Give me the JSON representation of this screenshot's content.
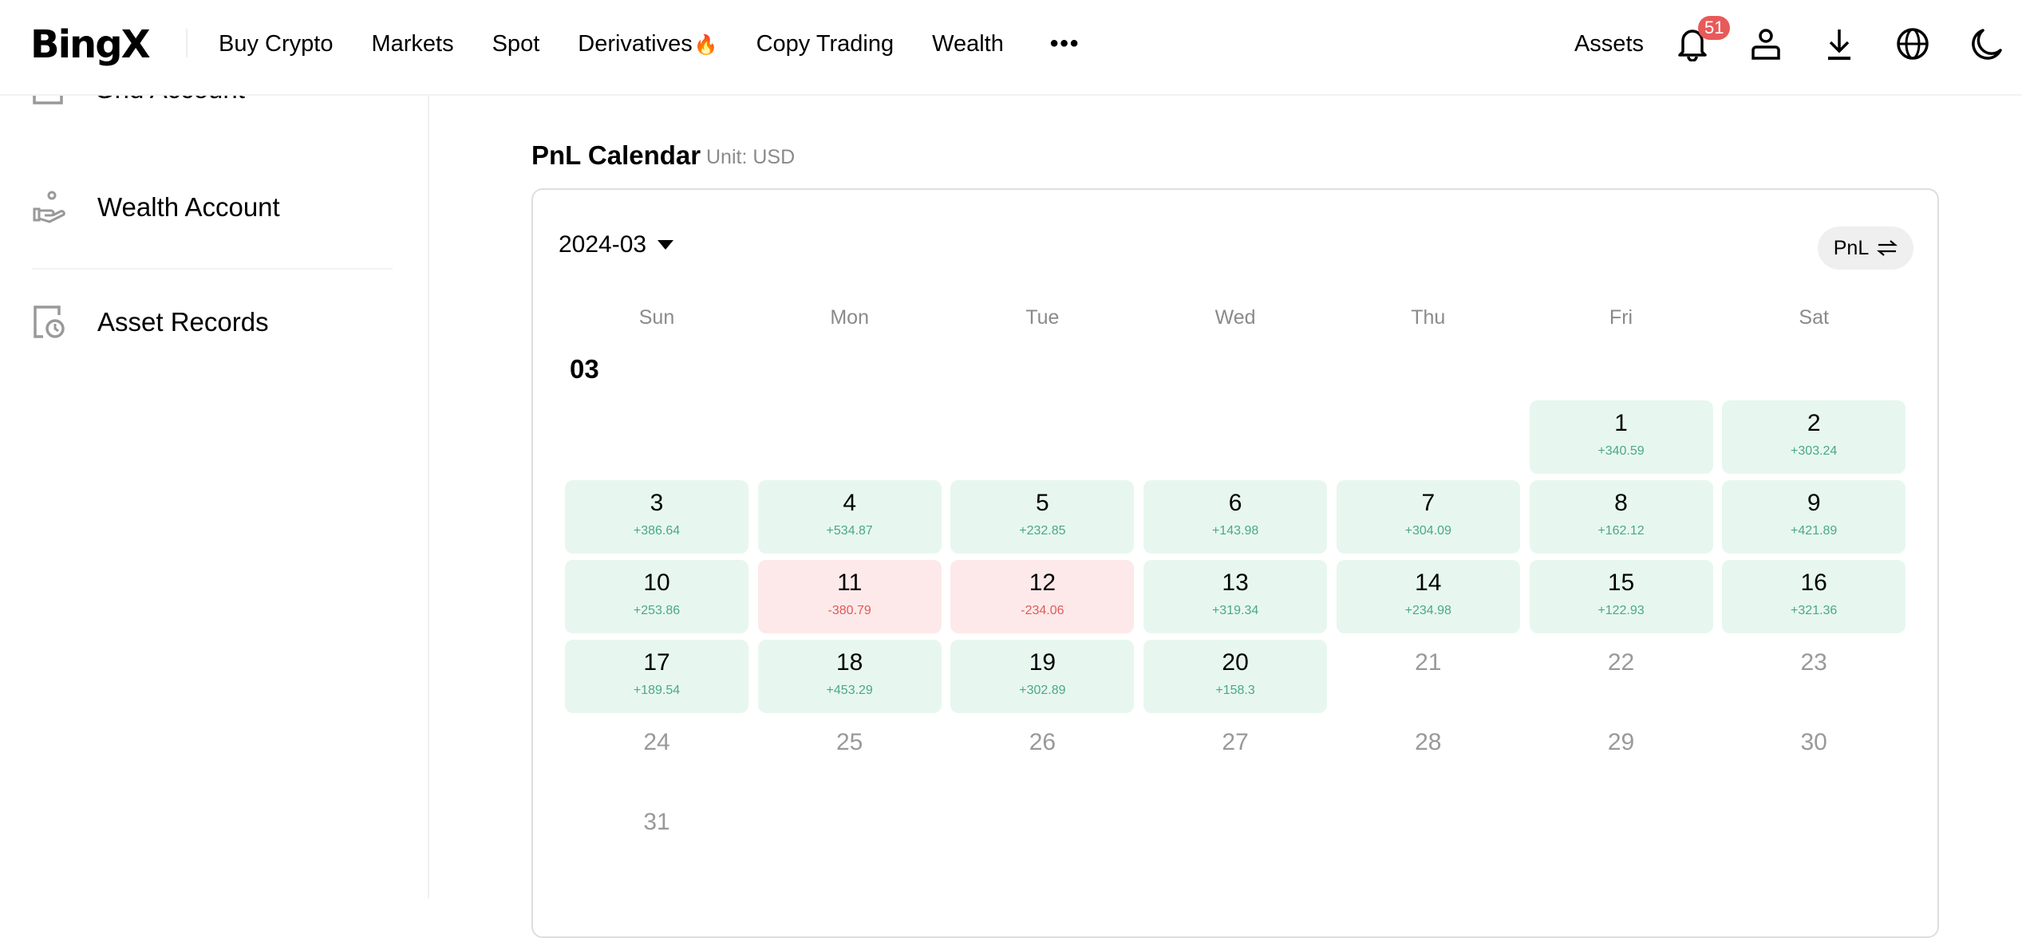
{
  "header": {
    "logo": "BingX",
    "nav": [
      {
        "label": "Buy Crypto"
      },
      {
        "label": "Markets"
      },
      {
        "label": "Spot"
      },
      {
        "label": "Derivatives",
        "badge_icon": "fire-icon"
      },
      {
        "label": "Copy Trading"
      },
      {
        "label": "Wealth"
      }
    ],
    "more_label": "•••",
    "assets_label": "Assets",
    "notification_count": "51"
  },
  "sidebar": {
    "items": [
      {
        "label": "Grid Account",
        "icon": "grid-account-icon"
      },
      {
        "label": "Wealth Account",
        "icon": "hand-coin-icon"
      },
      {
        "label": "Asset Records",
        "icon": "records-clock-icon"
      }
    ]
  },
  "calendar": {
    "title": "PnL Calendar",
    "unit": "Unit: USD",
    "selected_month": "2024-03",
    "toggle_label": "PnL",
    "month_label": "03",
    "weekdays": [
      "Sun",
      "Mon",
      "Tue",
      "Wed",
      "Thu",
      "Fri",
      "Sat"
    ],
    "first_weekday_index": 5,
    "days": [
      {
        "day": "1",
        "pnl": "+340.59"
      },
      {
        "day": "2",
        "pnl": "+303.24"
      },
      {
        "day": "3",
        "pnl": "+386.64"
      },
      {
        "day": "4",
        "pnl": "+534.87"
      },
      {
        "day": "5",
        "pnl": "+232.85"
      },
      {
        "day": "6",
        "pnl": "+143.98"
      },
      {
        "day": "7",
        "pnl": "+304.09"
      },
      {
        "day": "8",
        "pnl": "+162.12"
      },
      {
        "day": "9",
        "pnl": "+421.89"
      },
      {
        "day": "10",
        "pnl": "+253.86"
      },
      {
        "day": "11",
        "pnl": "-380.79"
      },
      {
        "day": "12",
        "pnl": "-234.06"
      },
      {
        "day": "13",
        "pnl": "+319.34"
      },
      {
        "day": "14",
        "pnl": "+234.98"
      },
      {
        "day": "15",
        "pnl": "+122.93"
      },
      {
        "day": "16",
        "pnl": "+321.36"
      },
      {
        "day": "17",
        "pnl": "+189.54"
      },
      {
        "day": "18",
        "pnl": "+453.29"
      },
      {
        "day": "19",
        "pnl": "+302.89"
      },
      {
        "day": "20",
        "pnl": "+158.3"
      },
      {
        "day": "21",
        "pnl": null
      },
      {
        "day": "22",
        "pnl": null
      },
      {
        "day": "23",
        "pnl": null
      },
      {
        "day": "24",
        "pnl": null
      },
      {
        "day": "25",
        "pnl": null
      },
      {
        "day": "26",
        "pnl": null
      },
      {
        "day": "27",
        "pnl": null
      },
      {
        "day": "28",
        "pnl": null
      },
      {
        "day": "29",
        "pnl": null
      },
      {
        "day": "30",
        "pnl": null
      },
      {
        "day": "31",
        "pnl": null
      }
    ],
    "colors": {
      "positive_bg": "#e7f7ef",
      "positive_text": "#4aa888",
      "negative_bg": "#fde9e9",
      "negative_text": "#e05a5a"
    }
  }
}
